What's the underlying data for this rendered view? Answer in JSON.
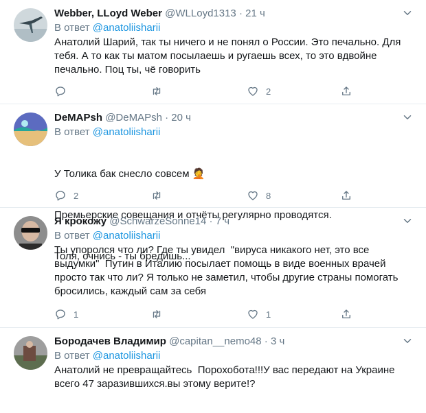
{
  "tweets": [
    {
      "name": "Webber, LLoyd Weber",
      "handle": "@WLLoyd1313",
      "dot": "·",
      "time": "21 ч",
      "reply_prefix": "В ответ",
      "reply_to": "@anatoliisharii",
      "text": "Анатолий Шарий, так ты ничего и не понял о России. Это печально. Для тебя. А то как ты матом посылаешь и ругаешь всех, то это вдвойне печально. Поц ты, чё говорить",
      "reply_count": "",
      "retweet_count": "",
      "like_count": "2"
    },
    {
      "name": "DeMAPsh",
      "handle": "@DeMAPsh",
      "dot": "·",
      "time": "20 ч",
      "reply_prefix": "В ответ",
      "reply_to": "@anatoliisharii",
      "text": "У Толика бак снесло совсем",
      "text_emoji": "🤦",
      "text_lines": [
        "Премьерские совещания и отчёты регулярно проводятся.",
        "Толя, очнись - ты бредишь..."
      ],
      "reply_count": "2",
      "retweet_count": "",
      "like_count": "8"
    },
    {
      "name": "Я крокожу",
      "handle": "@SchwarzeSonne14",
      "dot": "·",
      "time": "7 ч",
      "reply_prefix": "В ответ",
      "reply_to": "@anatoliisharii",
      "text": "Ты упоролся что ли? Где ты увидел  \"вируса никакого нет, это все выдумки\"  Путин в Италию посылает помощь в виде военных врачей просто так что ли? Я только не заметил, чтобы другие страны помогать бросились, каждый сам за себя",
      "reply_count": "1",
      "retweet_count": "",
      "like_count": "1"
    },
    {
      "name": "Бородачев Владимир",
      "handle": "@capitan__nemo48",
      "dot": "·",
      "time": "3 ч",
      "reply_prefix": "В ответ",
      "reply_to": "@anatoliisharii",
      "text": "Анатолий не превращайтесь  Порохобота!!!У вас передают на Украине всего 47 заразившихся.вы этому верите!?",
      "reply_count": "",
      "retweet_count": "",
      "like_count": ""
    }
  ],
  "icons": {
    "reply": "reply-icon",
    "retweet": "retweet-icon",
    "like": "heart-icon",
    "share": "share-icon",
    "caret": "chevron-down-icon"
  },
  "colors": {
    "link": "#1b95e0",
    "muted": "#657786",
    "text": "#14171a",
    "divider": "#e6ecf0"
  }
}
